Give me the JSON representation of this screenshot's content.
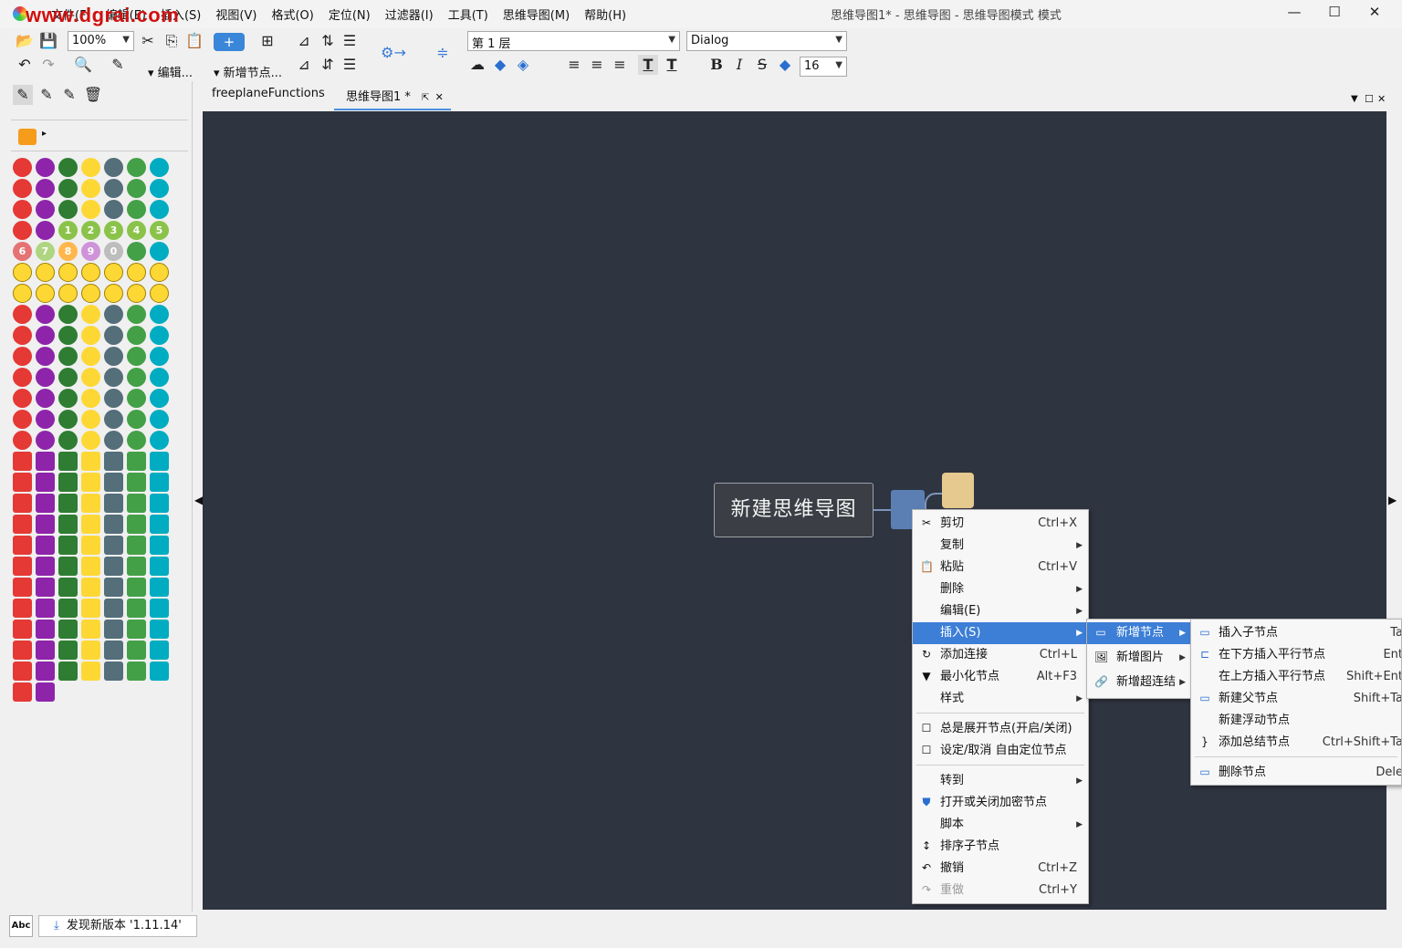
{
  "watermark": "www.dgrai.com",
  "window": {
    "title": "思维导图1* - 思维导图 - 思维导图模式 模式",
    "minimize": "—",
    "maximize": "☐",
    "close": "✕"
  },
  "menubar": [
    "文件(F)",
    "编辑(E)",
    "插入(S)",
    "视图(V)",
    "格式(O)",
    "定位(N)",
    "过滤器(I)",
    "工具(T)",
    "思维导图(M)",
    "帮助(H)"
  ],
  "toolbar": {
    "zoom": "100%",
    "edit_label": "编辑...",
    "new_node_label": "新增节点...",
    "level": "第 1 层",
    "font": "Dialog",
    "font_size": "16"
  },
  "tabs": [
    {
      "label": "freeplaneFunctions",
      "active": false
    },
    {
      "label": "思维导图1 *",
      "active": true
    }
  ],
  "mindmap": {
    "root": "新建思维导图"
  },
  "context_menu": [
    {
      "label": "剪切",
      "shortcut": "Ctrl+X",
      "icon": "✂"
    },
    {
      "label": "复制",
      "submenu": true
    },
    {
      "label": "粘贴",
      "shortcut": "Ctrl+V",
      "icon": "📋"
    },
    {
      "label": "删除",
      "submenu": true
    },
    {
      "label": "编辑(E)",
      "submenu": true
    },
    {
      "label": "插入(S)",
      "submenu": true,
      "highlight": true
    },
    {
      "label": "添加连接",
      "shortcut": "Ctrl+L",
      "icon": "↻"
    },
    {
      "label": "最小化节点",
      "shortcut": "Alt+F3",
      "icon": "▼"
    },
    {
      "label": "样式",
      "submenu": true
    },
    {
      "label": "总是展开节点(开启/关闭)",
      "icon": "☐"
    },
    {
      "label": "设定/取消 自由定位节点",
      "icon": "☐"
    },
    {
      "label": "转到",
      "submenu": true
    },
    {
      "label": "打开或关闭加密节点",
      "icon": "⛊"
    },
    {
      "label": "脚本",
      "submenu": true
    },
    {
      "label": "排序子节点",
      "icon": "↕"
    },
    {
      "label": "撤销",
      "shortcut": "Ctrl+Z",
      "icon": "↶"
    },
    {
      "label": "重做",
      "shortcut": "Ctrl+Y",
      "icon": "↷",
      "disabled": true
    }
  ],
  "insert_submenu": [
    {
      "label": "新增节点",
      "highlight": true
    },
    {
      "label": "新增图片"
    },
    {
      "label": "新增超连结"
    }
  ],
  "node_submenu": [
    {
      "label": "插入子节点",
      "shortcut": "Ta"
    },
    {
      "label": "在下方插入平行节点",
      "shortcut": "Ent"
    },
    {
      "label": "在上方插入平行节点",
      "shortcut": "Shift+Ent"
    },
    {
      "label": "新建父节点",
      "shortcut": "Shift+Ta"
    },
    {
      "label": "新建浮动节点",
      "shortcut": ""
    },
    {
      "label": "添加总结节点",
      "shortcut": "Ctrl+Shift+Ta"
    },
    {
      "label": "删除节点",
      "shortcut": "Dele"
    }
  ],
  "statusbar": {
    "abc": "Abc",
    "update": "发现新版本 '1.11.14'"
  },
  "icon_numbers": [
    "1",
    "2",
    "3",
    "4",
    "5",
    "6",
    "7",
    "8",
    "9",
    "0"
  ],
  "colors": {
    "canvas": "#2e3440",
    "highlight": "#3d7fd6",
    "node_blue": "#5b7fb3",
    "node_tan": "#e6c98e"
  }
}
